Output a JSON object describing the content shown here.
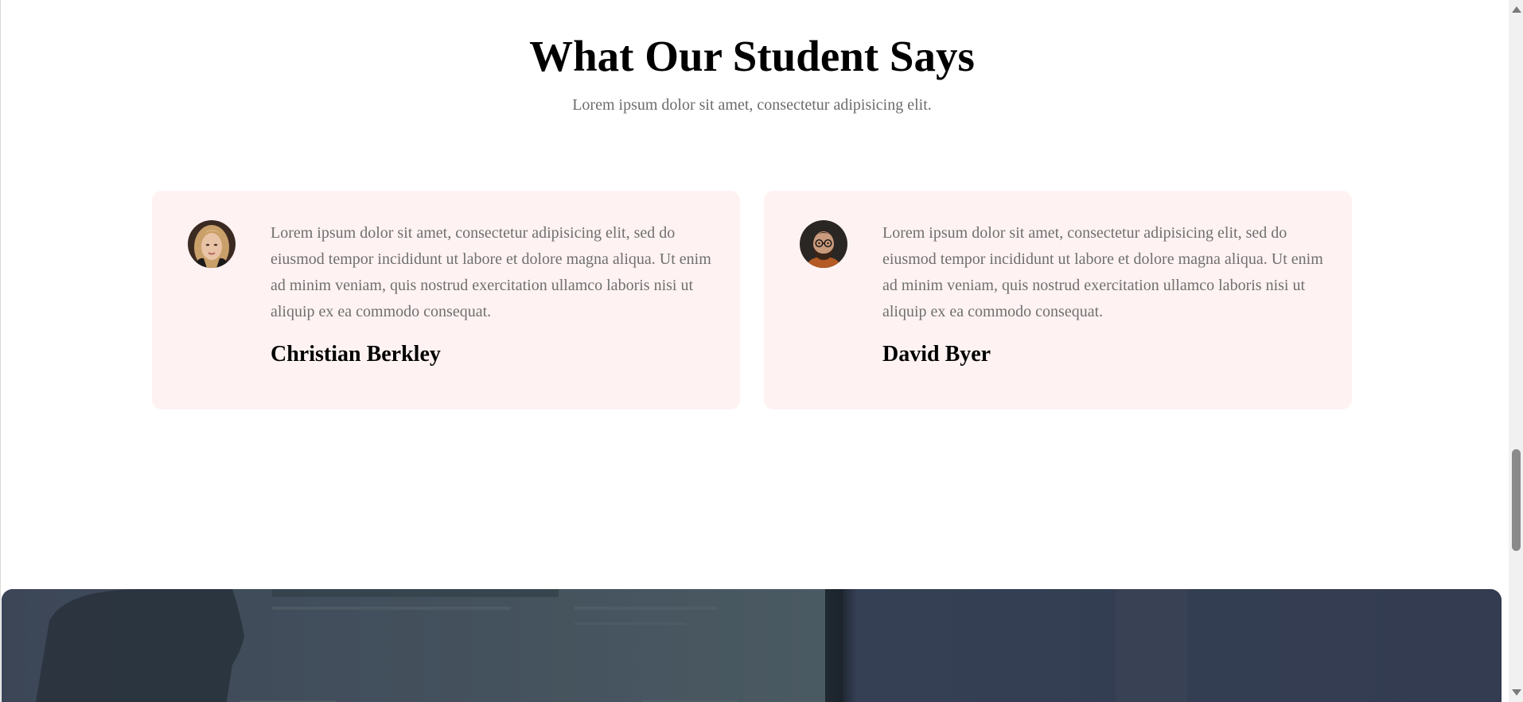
{
  "testimonials_section": {
    "title": "What Our Student Says",
    "subtitle": "Lorem ipsum dolor sit amet, consectetur adipisicing elit."
  },
  "testimonials": [
    {
      "quote": "Lorem ipsum dolor sit amet, consectetur adipisicing elit, sed do eiusmod tempor incididunt ut labore et dolore magna aliqua. Ut enim ad minim veniam, quis nostrud exercitation ullamco laboris nisi ut aliquip ex ea commodo consequat.",
      "name": "Christian Berkley",
      "avatar_icon": "woman-portrait-photo"
    },
    {
      "quote": "Lorem ipsum dolor sit amet, consectetur adipisicing elit, sed do eiusmod tempor incididunt ut labore et dolore magna aliqua. Ut enim ad minim veniam, quis nostrud exercitation ullamco laboris nisi ut aliquip ex ea commodo consequat.",
      "name": "David Byer",
      "avatar_icon": "bearded-man-portrait-photo"
    }
  ],
  "colors": {
    "card_background": "#fff2f2",
    "text_muted": "#6f6f6f",
    "heading": "#000000",
    "banner_overlay": "#353e52"
  },
  "scrollbar": {
    "up_icon": "triangle-up-icon",
    "down_icon": "triangle-down-icon"
  }
}
